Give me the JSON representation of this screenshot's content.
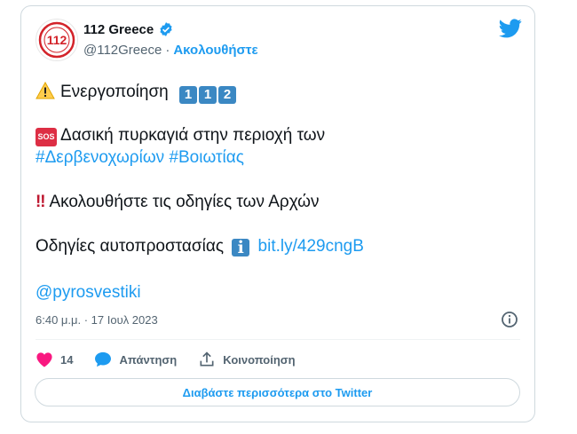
{
  "tweet": {
    "author": {
      "name": "112 Greece",
      "handle": "@112Greece",
      "avatar_text": "112",
      "follow_label": "Ακολουθήστε",
      "separator": "·"
    },
    "lines": {
      "activation": "Ενεργοποίηση",
      "keycaps": [
        "1",
        "1",
        "2"
      ],
      "sos_badge": "SOS",
      "fire_text": "Δασική πυρκαγιά στην περιοχή των",
      "hashtag1": "#Δερβενοχωρίων",
      "hashtag2": "#Βοιωτίας",
      "bang": "‼",
      "follow_text": "Ακολουθήστε τις οδηγίες των Αρχών",
      "self_protection": "Οδηγίες αυτοπροστασίας",
      "info_badge": "i",
      "link": "bit.ly/429cngB",
      "mention": "@pyrosvestiki"
    },
    "timestamp": "6:40 μ.μ. · 17 Ιουλ 2023",
    "actions": {
      "like_count": "14",
      "reply_label": "Απάντηση",
      "share_label": "Κοινοποίηση"
    },
    "read_more": "Διαβάστε περισσότερα στο Twitter"
  },
  "colors": {
    "accent": "#1d9bf0",
    "like": "#f91880",
    "keycap": "#3b88c3",
    "sos": "#dd2e44",
    "avatar_red": "#d3232a"
  },
  "icons": [
    "verified-badge-icon",
    "twitter-bird-icon",
    "warning-icon",
    "info-circle-icon",
    "heart-icon",
    "reply-bubble-icon",
    "share-icon"
  ]
}
